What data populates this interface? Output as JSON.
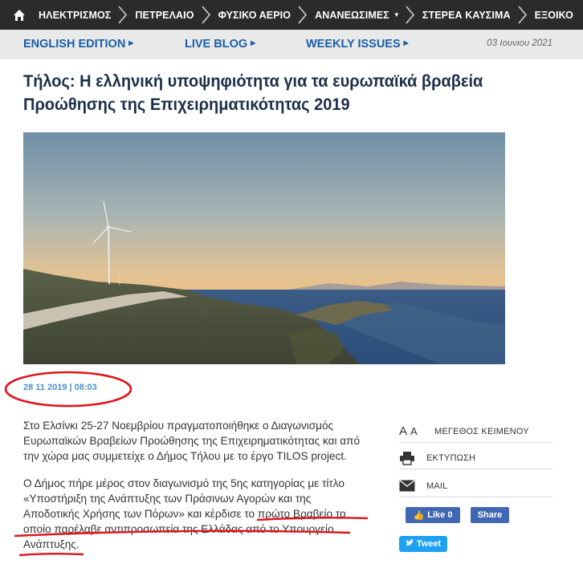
{
  "nav": {
    "items": [
      {
        "label": "ΗΛΕΚΤΡΙΣΜΟΣ"
      },
      {
        "label": "ΠΕΤΡΕΛΑΙΟ"
      },
      {
        "label": "ΦΥΣΙΚΟ ΑΕΡΙΟ"
      },
      {
        "label": "ΑΝΑΝΕΩΣΙΜΕΣ",
        "dropdown": true
      },
      {
        "label": "ΣΤΕΡΕΑ ΚΑΥΣΙΜΑ"
      },
      {
        "label": "ΕΞΟΙΚΟ"
      }
    ]
  },
  "subbar": {
    "english": "ENGLISH EDITION",
    "liveblog": "LIVE BLOG",
    "weekly": "WEEKLY ISSUES",
    "date": "03 Ιουνιου 2021"
  },
  "article": {
    "title_line1": "Τήλος: Η ελληνική υποψηφιότητα για τα ευρωπαϊκά βραβεία",
    "title_line2": "Προώθησης της Επιχειρηματικότητας 2019",
    "timestamp": "28 11 2019 | 08:03",
    "p1_l1": "Στο Ελσίνκι 25-27 Νοεμβρίου πραγματοποιήθηκε ο Διαγωνισμός",
    "p1_l2": "Ευρωπαϊκών Βραβείων Προώθησης της Επιχειρηματικότητας και από",
    "p1_l3": "την χώρα μας συμμετείχε ο Δήμος Τήλου με το έργο TILOS project.",
    "p2_l1": "Ο Δήμος πήρε μέρος στον διαγωνισμό της 5ης κατηγορίας με τίτλο",
    "p2_l2": "«Υποστήριξη της Ανάπτυξης των Πράσινων Αγορών και της",
    "p2_l3": "Αποδοτικής Χρήσης των Πόρων» και κέρδισε το πρώτο Βραβείο το",
    "p2_l4": "οποίο παρέλαβε αντιπροσωπεία της Ελλάδας από το Υπουργείο",
    "p2_l5": "Ανάπτυξης."
  },
  "tools": {
    "font_big": "A",
    "font_small": "A",
    "font_size_label": "ΜΕΓΕΘΟΣ ΚΕΙΜΕΝΟΥ",
    "print_label": "ΕΚΤΥΠΩΣΗ",
    "mail_label": "MAIL"
  },
  "social": {
    "like_label": "Like 0",
    "share_label": "Share",
    "tweet_label": "Tweet"
  },
  "colors": {
    "nav_bg": "#2b2b2b",
    "link_blue": "#1a5fa8",
    "title": "#1c2f4a",
    "annotation_red": "#e0141c",
    "facebook": "#4267b2",
    "twitter": "#1da1f2"
  }
}
